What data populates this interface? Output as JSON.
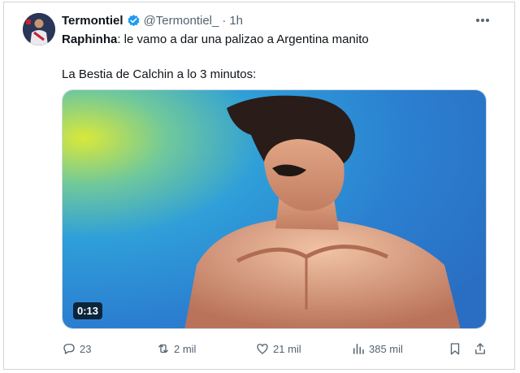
{
  "tweet": {
    "author_name": "Termontiel",
    "handle": "@Termontiel_",
    "separator": "·",
    "time": "1h",
    "line1_name": "Raphinha",
    "line1_rest": ": le vamo a dar una palizao a Argentina manito",
    "line2": "La Bestia de Calchin a lo 3 minutos:"
  },
  "media": {
    "duration": "0:13"
  },
  "actions": {
    "replies": "23",
    "reposts": "2 mil",
    "likes": "21 mil",
    "views": "385 mil"
  },
  "icons": [
    "verified-badge-icon",
    "more-icon",
    "reply-icon",
    "repost-icon",
    "like-icon",
    "views-icon",
    "bookmark-icon",
    "share-icon"
  ],
  "colors": {
    "verified": "#1d9bf0",
    "muted": "#536471",
    "text": "#0f1419"
  }
}
